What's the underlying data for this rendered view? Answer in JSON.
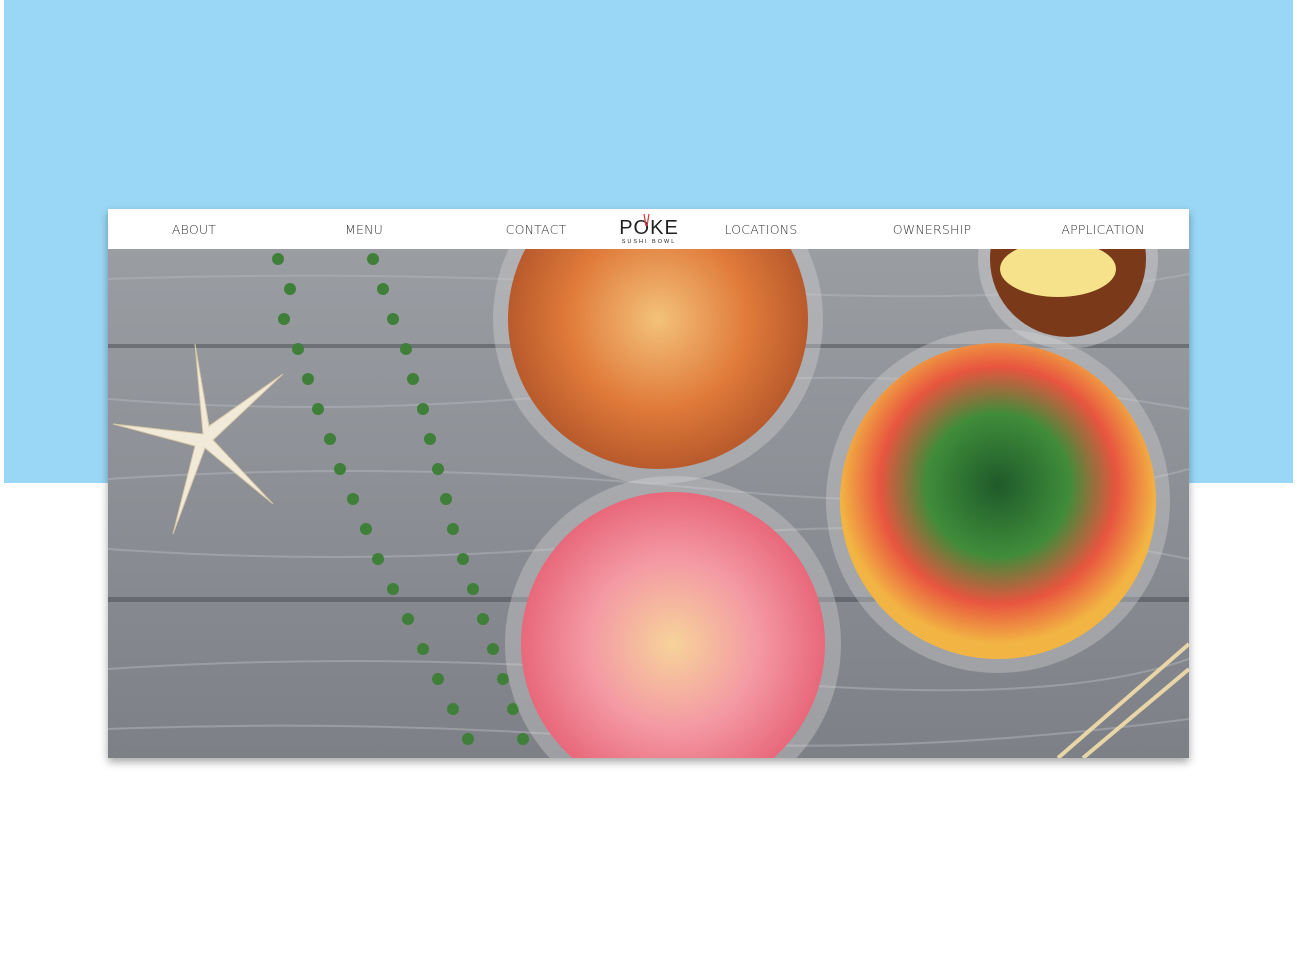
{
  "nav": {
    "items": [
      {
        "label": "ABOUT"
      },
      {
        "label": "MENU"
      },
      {
        "label": "CONTACT"
      },
      {
        "label": "LOCATIONS"
      },
      {
        "label": "OWNERSHIP"
      },
      {
        "label": "APPLICATION"
      }
    ]
  },
  "logo": {
    "word": "POKE",
    "tagline": "SUSHI BOWL"
  },
  "colors": {
    "sky": "#9ad7f6",
    "wood": "#8a8d92",
    "nav_text": "#333333"
  },
  "hero": {
    "icon": "poke-bowls-photo"
  }
}
